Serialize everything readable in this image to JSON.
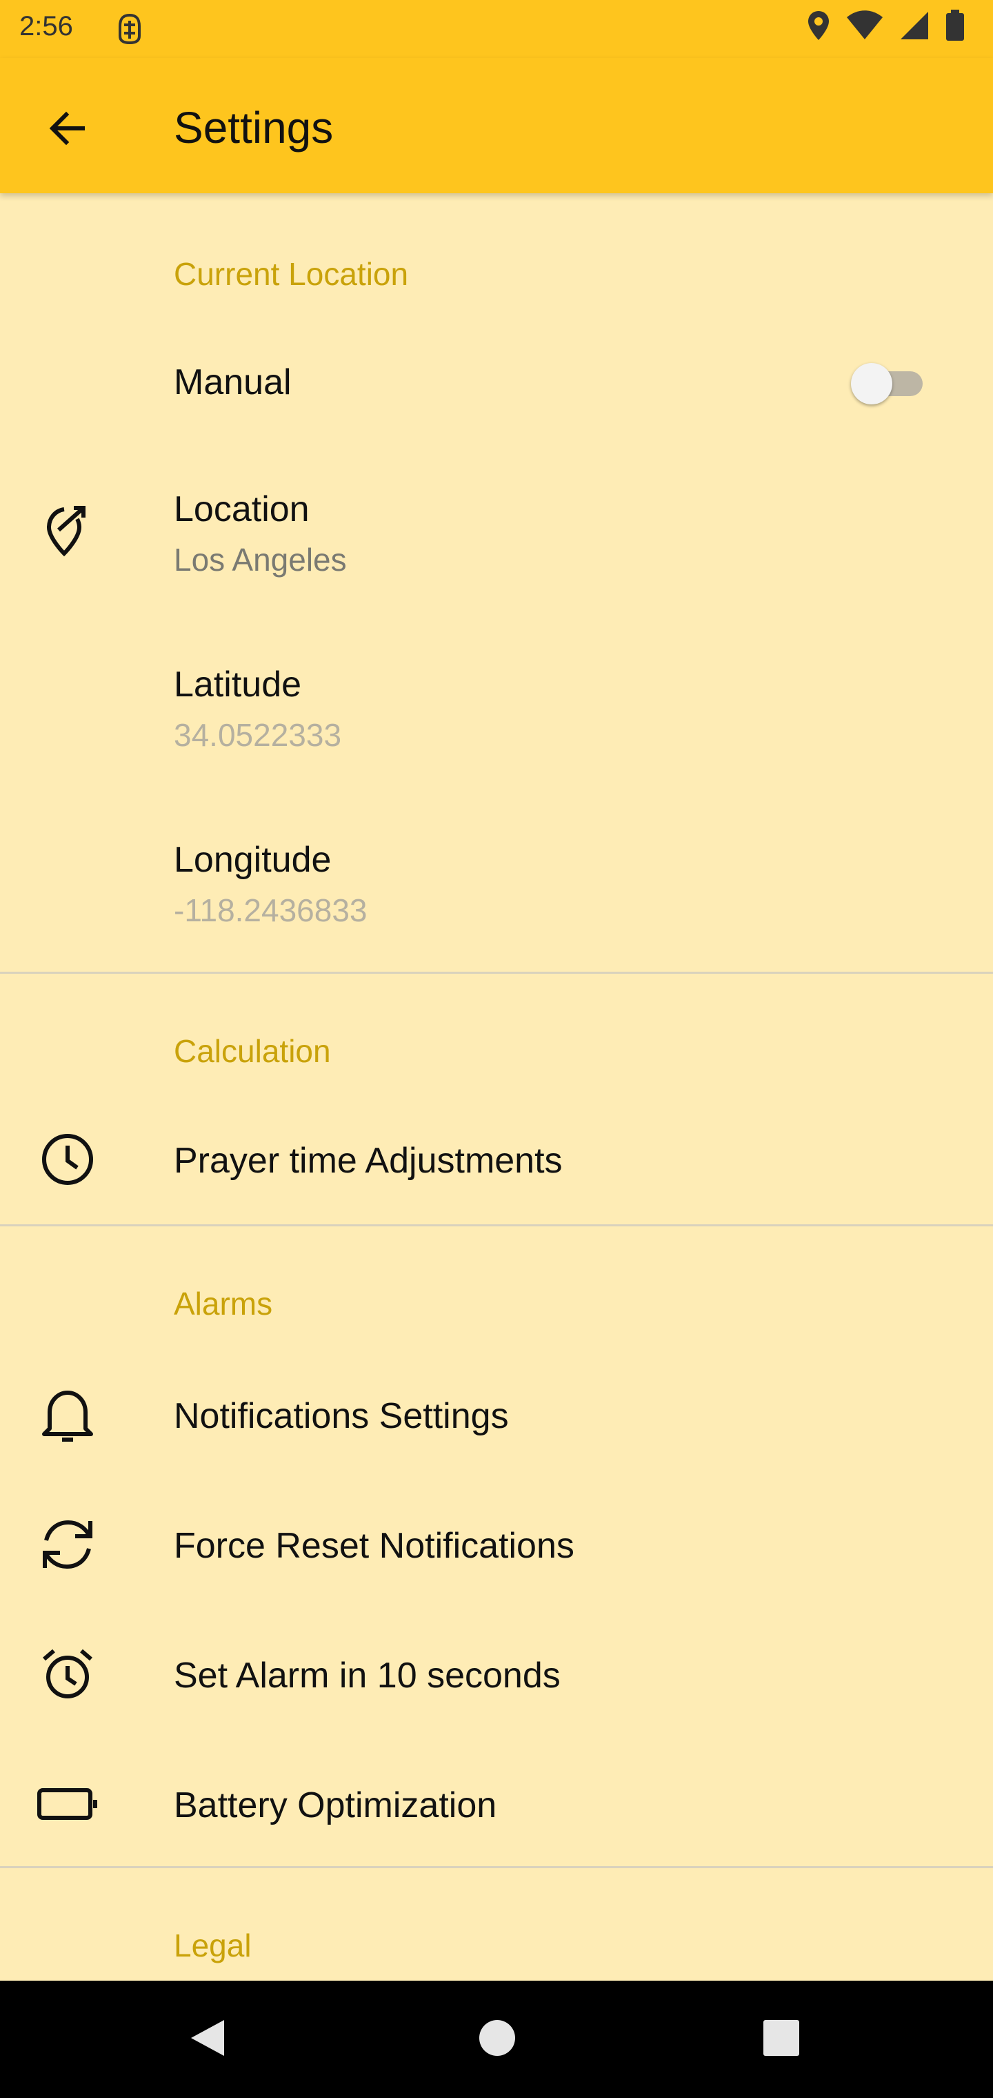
{
  "status_bar": {
    "time": "2:56",
    "icons": [
      "sim-status-icon",
      "location-icon",
      "wifi-icon",
      "signal-icon",
      "battery-icon"
    ]
  },
  "app_bar": {
    "title": "Settings",
    "back_icon": "arrow-left-icon"
  },
  "sections": {
    "current_location": {
      "header": "Current Location",
      "manual": {
        "title": "Manual",
        "toggle_on": false
      },
      "location": {
        "title": "Location",
        "value": "Los Angeles",
        "icon": "location-edit-icon"
      },
      "latitude": {
        "title": "Latitude",
        "value": "34.0522333"
      },
      "longitude": {
        "title": "Longitude",
        "value": "-118.2436833"
      }
    },
    "calculation": {
      "header": "Calculation",
      "prayer_adjustments": {
        "title": "Prayer time Adjustments",
        "icon": "clock-icon"
      }
    },
    "alarms": {
      "header": "Alarms",
      "notifications_settings": {
        "title": "Notifications Settings",
        "icon": "bell-icon"
      },
      "force_reset": {
        "title": "Force Reset Notifications",
        "icon": "refresh-icon"
      },
      "set_alarm": {
        "title": "Set Alarm in 10 seconds",
        "icon": "alarm-clock-icon"
      },
      "battery_optimization": {
        "title": "Battery Optimization",
        "icon": "battery-outline-icon"
      }
    },
    "legal": {
      "header": "Legal"
    }
  },
  "colors": {
    "app_bar": "#FEC51E",
    "background": "#FEECB5",
    "section_header": "#C9A20A"
  },
  "nav_bar": {
    "icons": [
      "nav-back-icon",
      "nav-home-icon",
      "nav-recents-icon"
    ]
  }
}
